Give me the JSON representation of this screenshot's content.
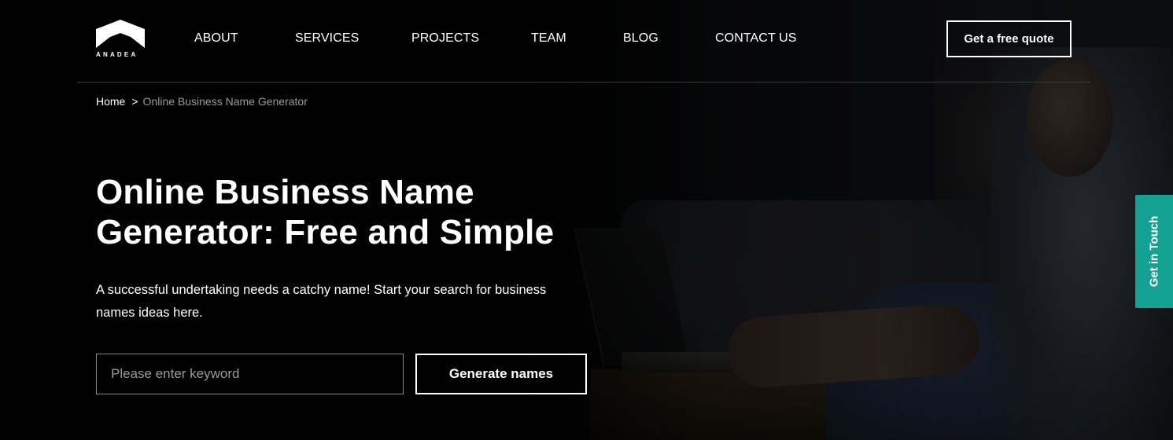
{
  "brand": {
    "name": "ANADEA",
    "logo_icon": "anadea-house-mark-icon"
  },
  "nav": {
    "items": [
      {
        "label": "ABOUT"
      },
      {
        "label": "SERVICES"
      },
      {
        "label": "PROJECTS"
      },
      {
        "label": "TEAM"
      },
      {
        "label": "BLOG"
      },
      {
        "label": "CONTACT US"
      }
    ],
    "cta_label": "Get a free quote"
  },
  "breadcrumb": {
    "home": "Home",
    "separator": ">",
    "current": "Online Business Name Generator"
  },
  "hero": {
    "title_line1": "Online Business Name",
    "title_line2": "Generator: Free and Simple",
    "subtitle": "A successful undertaking needs a catchy name! Start your search for business names ideas here."
  },
  "search": {
    "value": "",
    "placeholder": "Please enter keyword",
    "button_label": "Generate names"
  },
  "side_tab": {
    "label": "Get in Touch"
  },
  "colors": {
    "background": "#000000",
    "text": "#ffffff",
    "muted_text": "#9a9a9a",
    "side_tab": "#13a193"
  }
}
